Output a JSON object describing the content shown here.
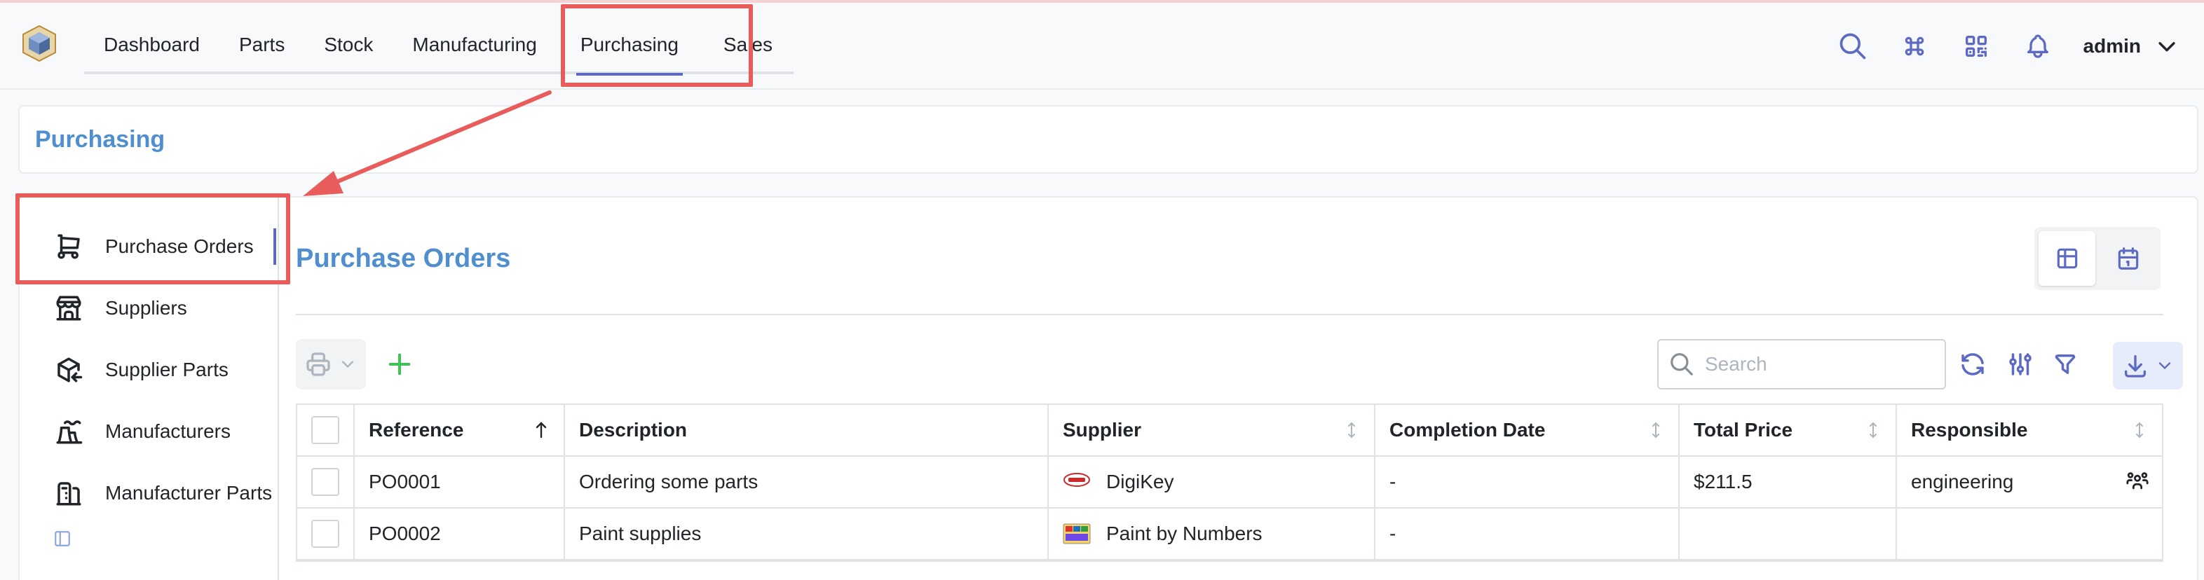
{
  "header": {
    "tabs": [
      {
        "label": "Dashboard"
      },
      {
        "label": "Parts"
      },
      {
        "label": "Stock"
      },
      {
        "label": "Manufacturing"
      },
      {
        "label": "Purchasing",
        "active": true
      },
      {
        "label": "Sales"
      }
    ],
    "user": "admin",
    "icons": [
      "search-icon",
      "command-icon",
      "qr-code-icon",
      "bell-icon",
      "chevron-down-icon"
    ]
  },
  "page": {
    "title": "Purchasing"
  },
  "sidebar": {
    "items": [
      {
        "label": "Purchase Orders",
        "icon": "cart-icon",
        "active": true
      },
      {
        "label": "Suppliers",
        "icon": "store-icon"
      },
      {
        "label": "Supplier Parts",
        "icon": "package-import-icon"
      },
      {
        "label": "Manufacturers",
        "icon": "factory-icon"
      },
      {
        "label": "Manufacturer Parts",
        "icon": "building-factory-icon"
      }
    ]
  },
  "section": {
    "title": "Purchase Orders"
  },
  "toolbar": {
    "search_placeholder": "Search"
  },
  "table": {
    "columns": [
      "Reference",
      "Description",
      "Supplier",
      "Completion Date",
      "Total Price",
      "Responsible"
    ],
    "rows": [
      {
        "reference": "PO0001",
        "description": "Ordering some parts",
        "supplier": "DigiKey",
        "completion_date": "-",
        "total_price": "$211.5",
        "responsible": "engineering"
      },
      {
        "reference": "PO0002",
        "description": "Paint supplies",
        "supplier": "Paint by Numbers",
        "completion_date": "-",
        "total_price": "",
        "responsible": ""
      }
    ]
  },
  "colors": {
    "accent": "#5c6ac4",
    "title": "#4f8fcf",
    "highlight": "#e85c5c",
    "add": "#40c057"
  }
}
